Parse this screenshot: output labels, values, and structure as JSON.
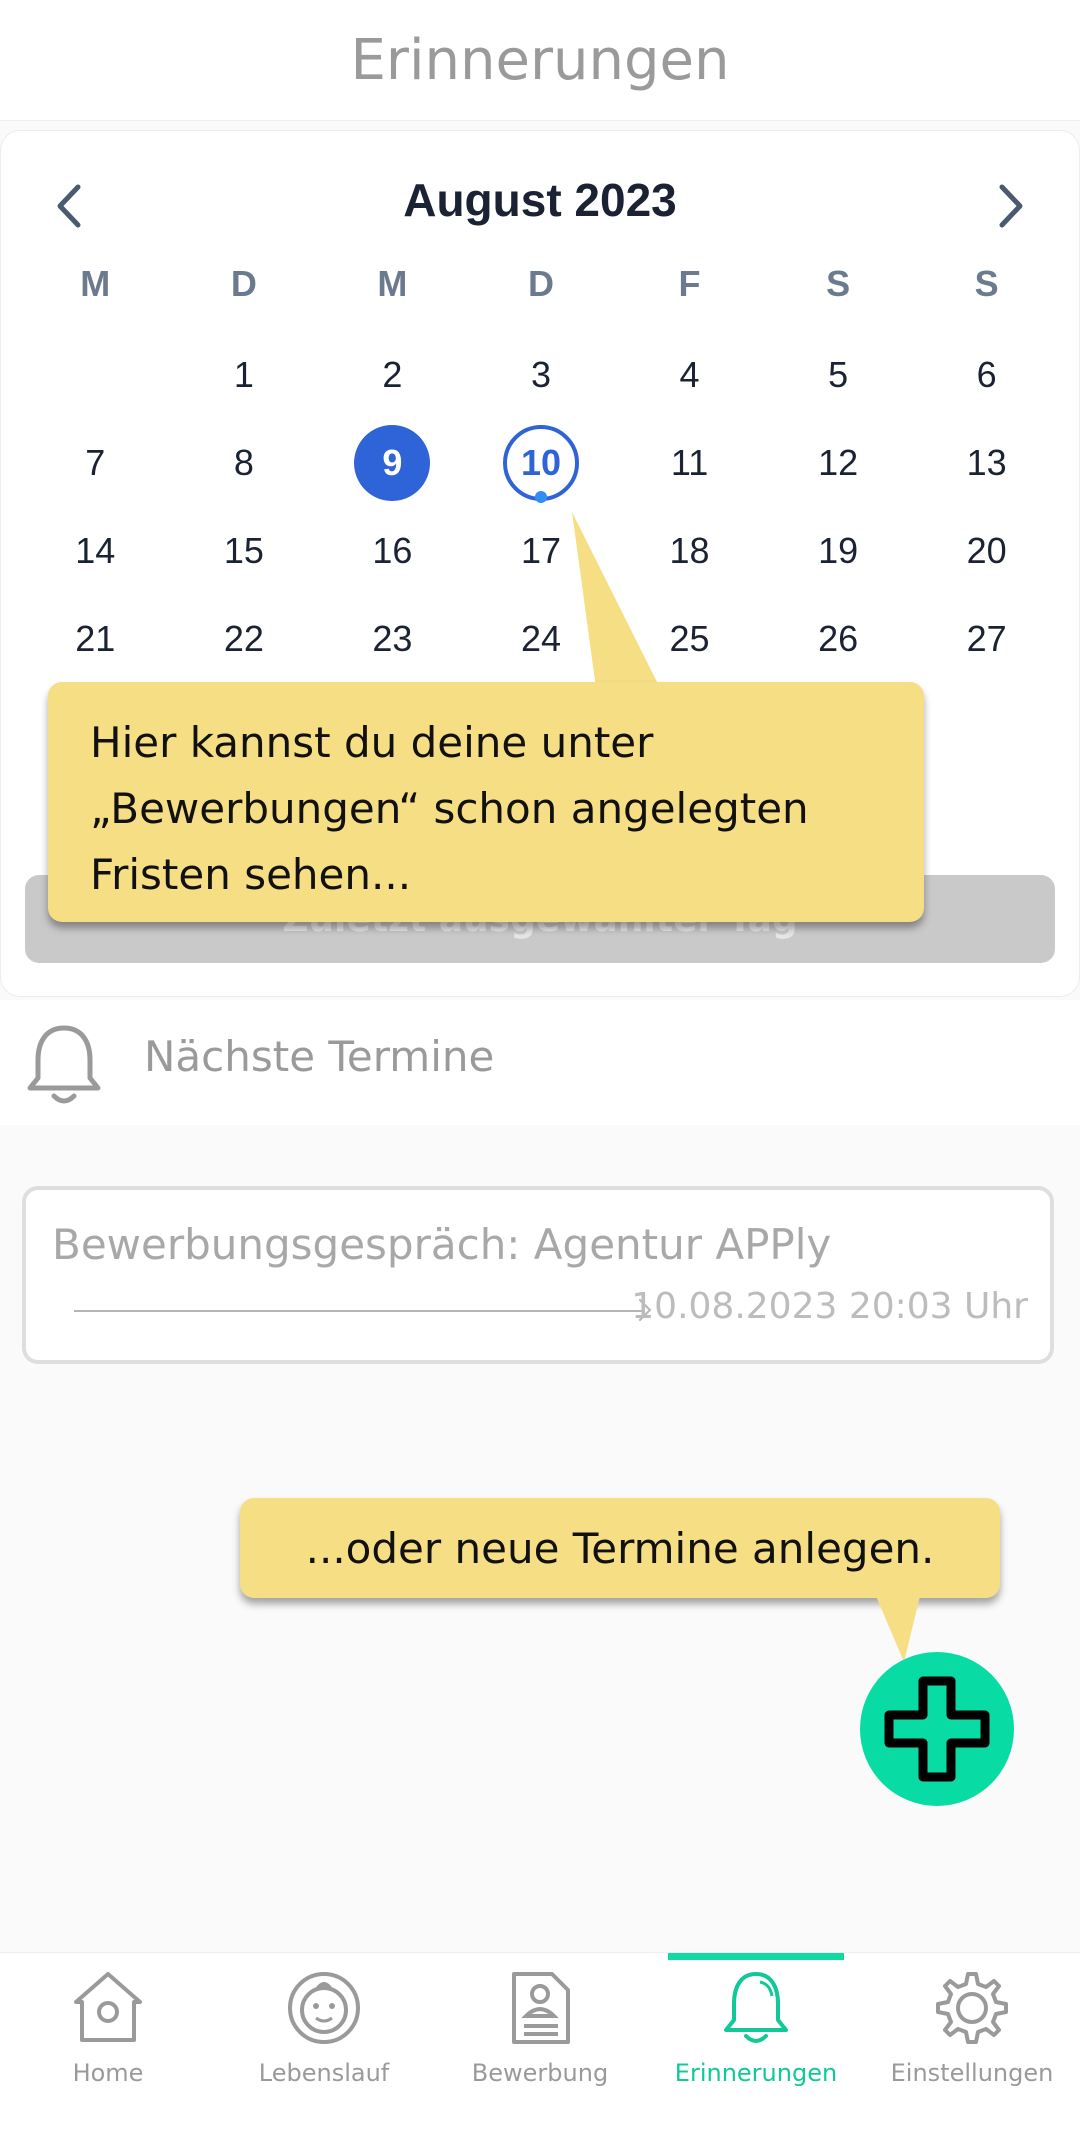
{
  "header": {
    "title": "Erinnerungen"
  },
  "calendar": {
    "month_title": "August 2023",
    "weekdays": [
      "M",
      "D",
      "M",
      "D",
      "F",
      "S",
      "S"
    ],
    "weeks": [
      [
        "",
        "1",
        "2",
        "3",
        "4",
        "5",
        "6"
      ],
      [
        "7",
        "8",
        "9",
        "10",
        "11",
        "12",
        "13"
      ],
      [
        "14",
        "15",
        "16",
        "17",
        "18",
        "19",
        "20"
      ],
      [
        "21",
        "22",
        "23",
        "24",
        "25",
        "26",
        "27"
      ]
    ],
    "selected_day": "9",
    "today_day": "10",
    "last_day_button_label": "Zuletzt ausgewählter Tag"
  },
  "tooltips": {
    "calendar_hint": "Hier kannst du deine unter „Bewerbungen“ schon angelegten Fristen sehen...",
    "add_hint": "...oder neue Termine anlegen."
  },
  "upcoming": {
    "section_title": "Nächste Termine",
    "appointment_title": "Bewerbungsgespräch: Agentur APPly",
    "appointment_time": "10.08.2023 20:03 Uhr"
  },
  "nav": {
    "items": [
      {
        "label": "Home",
        "icon": "birdhouse-icon"
      },
      {
        "label": "Lebenslauf",
        "icon": "face-icon"
      },
      {
        "label": "Bewerbung",
        "icon": "document-icon"
      },
      {
        "label": "Erinnerungen",
        "icon": "bell-icon"
      },
      {
        "label": "Einstellungen",
        "icon": "gear-icon"
      }
    ],
    "active": "Erinnerungen"
  },
  "colors": {
    "accent": "#10d9a1",
    "selected": "#2f63d8",
    "tooltip": "#f6de85"
  }
}
